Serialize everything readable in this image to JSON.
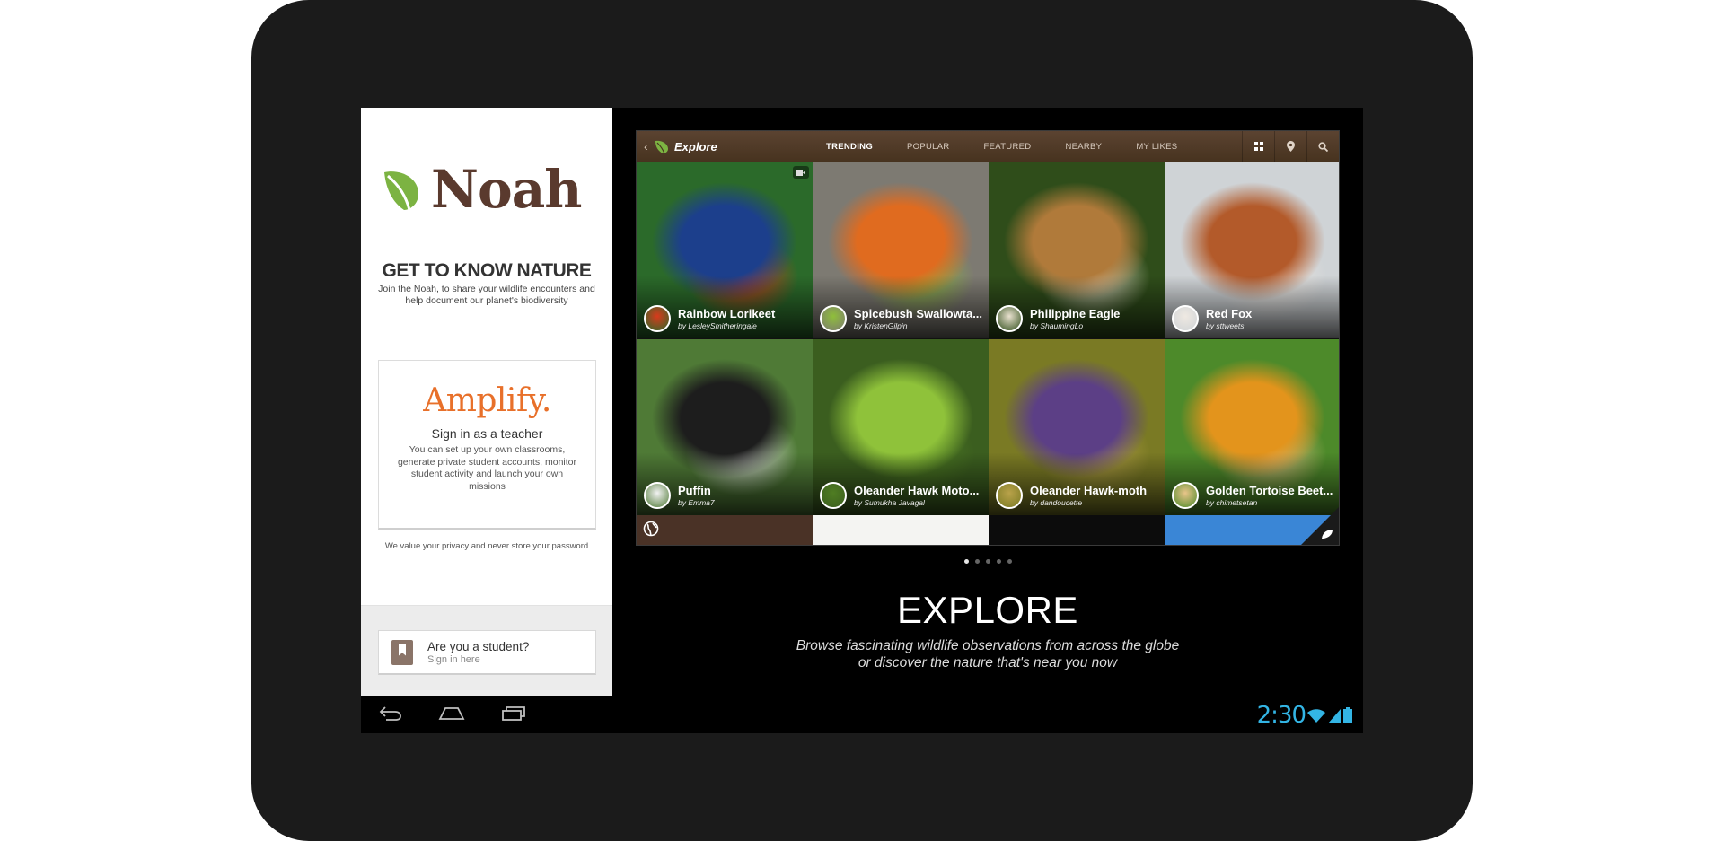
{
  "brand": {
    "name": "Noah",
    "leaf_color": "#7cb342",
    "text_color": "#5a3a2e"
  },
  "signup": {
    "headline": "GET TO KNOW NATURE",
    "subtext": "Join the Noah, to share your wildlife encounters and help document our planet's biodiversity"
  },
  "teacher": {
    "logo": "Amplify.",
    "title": "Sign in as a teacher",
    "description": "You can set up your own classrooms, generate private student accounts, monitor student activity and launch your own missions"
  },
  "privacy_note": "We value your privacy and never store your password",
  "student": {
    "title": "Are you a student?",
    "subtitle": "Sign in here",
    "icon": "bookmark-book-icon"
  },
  "app": {
    "title": "Explore",
    "tabs": [
      {
        "label": "TRENDING",
        "active": true
      },
      {
        "label": "POPULAR",
        "active": false
      },
      {
        "label": "FEATURED",
        "active": false
      },
      {
        "label": "NEARBY",
        "active": false
      },
      {
        "label": "MY LIKES",
        "active": false
      }
    ],
    "toolbar_icons": [
      "grid-icon",
      "location-pin-icon",
      "search-icon"
    ],
    "tiles": [
      {
        "name": "Rainbow Lorikeet",
        "by": "by LesleySmitheringale",
        "colors": [
          "#2b6a2a",
          "#1c3f8c",
          "#d93a1c"
        ],
        "video": true
      },
      {
        "name": "Spicebush Swallowta...",
        "by": "by KristenGilpin",
        "colors": [
          "#7d7a72",
          "#e06b1f",
          "#8fbf3a"
        ],
        "video": false
      },
      {
        "name": "Philippine Eagle",
        "by": "by ShaumingLo",
        "colors": [
          "#2f4d1a",
          "#b07a3a",
          "#e9e1cf"
        ],
        "video": false
      },
      {
        "name": "Red Fox",
        "by": "by sttweets",
        "colors": [
          "#cfd3d6",
          "#b35a2a",
          "#efe9e2"
        ],
        "video": false
      },
      {
        "name": "Puffin",
        "by": "by Emma7",
        "colors": [
          "#4f7a36",
          "#1d1d1d",
          "#f2f2f2"
        ],
        "video": false
      },
      {
        "name": "Oleander Hawk Moto...",
        "by": "by Sumukha Javagal",
        "colors": [
          "#3b5e1f",
          "#8fc23a",
          "#4f7d22"
        ],
        "video": false
      },
      {
        "name": "Oleander Hawk-moth",
        "by": "by dandoucette",
        "colors": [
          "#7a7a24",
          "#5c3f86",
          "#b9a24a"
        ],
        "video": false
      },
      {
        "name": "Golden Tortoise Beet...",
        "by": "by chimetsetan",
        "colors": [
          "#4d8a2a",
          "#e3941c",
          "#e9c58a"
        ],
        "video": false
      }
    ],
    "strip_colors": [
      "#4a3226",
      "#f4f4f2",
      "#0c0c0c",
      "#3a86d6"
    ]
  },
  "pager": {
    "count": 5,
    "active": 0
  },
  "feature": {
    "title": "EXPLORE",
    "description_line1": "Browse fascinating wildlife observations from across the globe",
    "description_line2": "or discover the nature that's near you now"
  },
  "system": {
    "time": "2:30",
    "accent": "#33b5e5",
    "nav_buttons": [
      "back-icon",
      "home-icon",
      "recent-apps-icon"
    ]
  }
}
